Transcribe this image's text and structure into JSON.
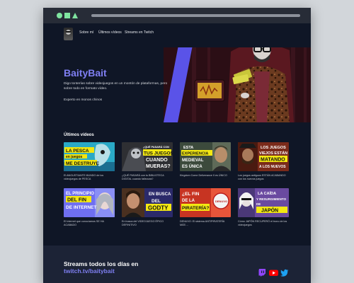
{
  "nav": {
    "links": [
      "Sobre mí",
      "Últimos vídeos",
      "Streams en Twitch"
    ]
  },
  "hero": {
    "title": "BaityBait",
    "description": "Digo tonterías sobre videojuegos en un montón de plataformas, pero sobre todo en formato vídeo.",
    "subtitle": "Experto en monos chinos"
  },
  "videos": {
    "section_title": "Últimos vídeos",
    "items": [
      {
        "thumb_text": "LA PESCA en juegos ME DESTRUYE",
        "caption": "El ANGUSTIANTE MUNDO de los videojuegos de PESCA"
      },
      {
        "thumb_text": "¿QUÉ PASARÁ CON TUS JUEGOS CUANDO MUERAS?",
        "caption": "¿QUÉ PASARÁ con tu BIBLIOTECA DIGITAL cuando fallezcas?"
      },
      {
        "thumb_text": "ESTA EXPERIENCIA MEDIEVAL ES ÚNICA",
        "caption": "Kingdom Come Deliverance II es ÚNICO"
      },
      {
        "thumb_text": "LOS JUEGOS VIEJOS ESTÁN MATANDO A LOS NUEVOS",
        "caption": "Los juegos antiguos ESTÁN ACABANDO con los nuevos juegos"
      },
      {
        "thumb_text": "EL PRINCIPIO DEL FIN DE INTERNET",
        "caption": "El Internet que conocíamos SE HA ACABADO"
      },
      {
        "thumb_text": "EN BUSCA DEL GODTY",
        "caption": "En busca del VIDEOJUEGO ÉPICO DEFINITIVO"
      },
      {
        "thumb_text": "¿EL FIN DE LA PIRATERÍA?",
        "caption": "DENUVO: El sistema ANTIPIRATERÍA MÁS ..."
      },
      {
        "thumb_text": "LA CAÍDA Y RESURGIMIENTO DE JAPÓN",
        "caption": "Cómo JAPÓN RECUPERÓ el trono de los videojuegos"
      }
    ]
  },
  "footer": {
    "line1": "Streams todos los días en",
    "line2": "twitch.tv/baitybait"
  },
  "colors": {
    "accent": "#7f7ff2",
    "background": "#0f1626",
    "footer": "#1c2336"
  }
}
